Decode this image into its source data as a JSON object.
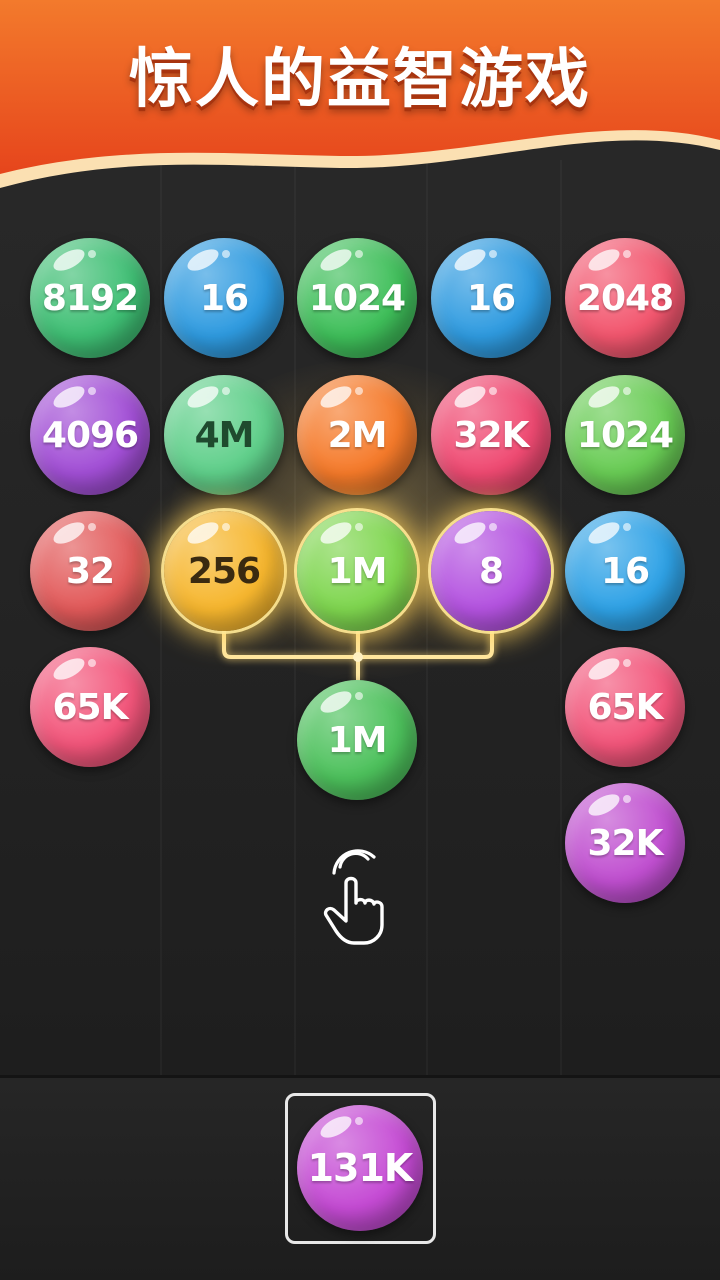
{
  "banner": {
    "title": "惊人的益智游戏"
  },
  "colors": {
    "banner_orange": "#ee5a24",
    "banner_cream": "#ffd9a8",
    "board_bg": "#262626",
    "glow": "#ffd77a"
  },
  "grid": {
    "rows": [
      [
        "8192",
        "16",
        "1024",
        "16",
        "2048"
      ],
      [
        "4096",
        "4M",
        "2M",
        "32K",
        "1024"
      ],
      [
        "32",
        "256",
        "1M",
        "8",
        "16"
      ],
      [
        "65K",
        "",
        "",
        "",
        "65K"
      ],
      [
        "",
        "",
        "",
        "",
        "32K"
      ]
    ],
    "ball_colors": [
      [
        "#3fbf74",
        "#2f9be0",
        "#3fbf5a",
        "#2f9be0",
        "#f2566e"
      ],
      [
        "#a24fd6",
        "#5fcf8a",
        "#f57a2a",
        "#ef4a72",
        "#69cc55"
      ],
      [
        "#e25a5a",
        "#f6b62e",
        "#7fd64f",
        "#b453e0",
        "#2fa2e6"
      ],
      [
        "#f2557a",
        "",
        "",
        "",
        "#f2557a"
      ],
      [
        "",
        "",
        "",
        "",
        "#c04fd0"
      ]
    ]
  },
  "merge": {
    "selected_cells": [
      "2-1",
      "2-2",
      "2-3"
    ],
    "result_value": "1M",
    "result_color": "#4dc15c"
  },
  "hand_icon": "tap-hand-icon",
  "next_ball": {
    "value": "131K",
    "color": "#c54bd4"
  }
}
